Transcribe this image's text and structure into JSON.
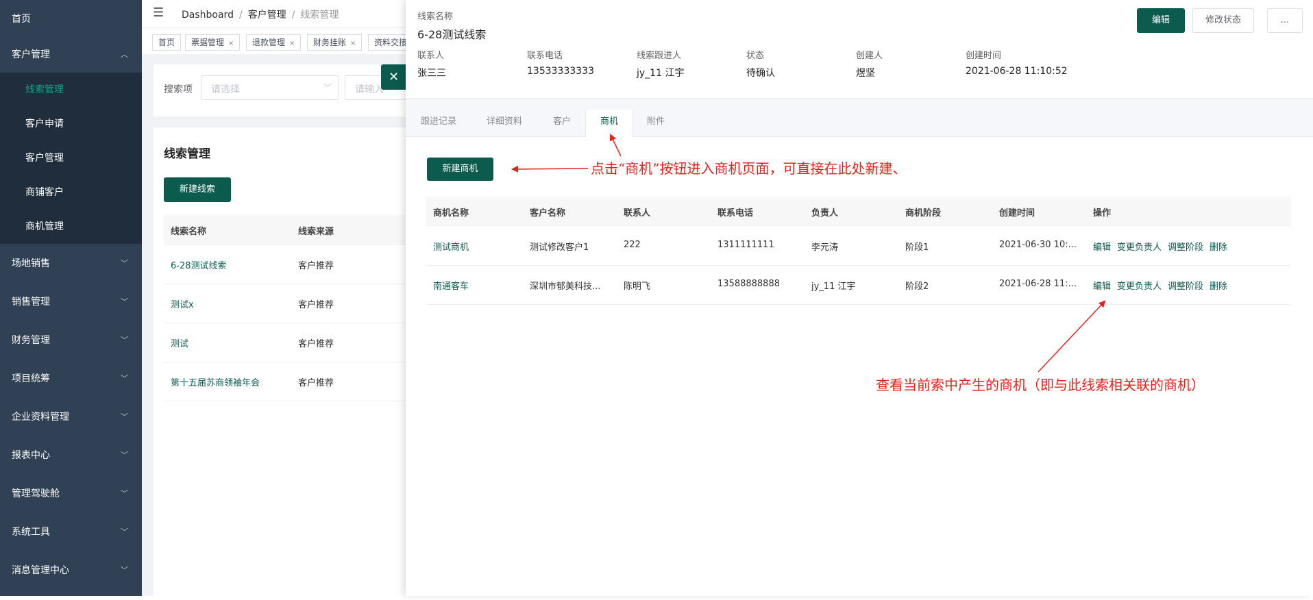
{
  "sidebar": {
    "top_items": [
      {
        "label": "首页"
      },
      {
        "label": "客户管理"
      }
    ],
    "sub_items": [
      {
        "label": "线索管理"
      },
      {
        "label": "客户申请"
      },
      {
        "label": "客户管理"
      },
      {
        "label": "商铺客户"
      },
      {
        "label": "商机管理"
      }
    ],
    "bottom_items": [
      {
        "label": "场地销售"
      },
      {
        "label": "销售管理"
      },
      {
        "label": "财务管理"
      },
      {
        "label": "项目统筹"
      },
      {
        "label": "企业资料管理"
      },
      {
        "label": "报表中心"
      },
      {
        "label": "管理驾驶舱"
      },
      {
        "label": "系统工具"
      },
      {
        "label": "消息管理中心"
      }
    ]
  },
  "header": {
    "breadcrumb": [
      "Dashboard",
      "客户管理",
      "线索管理"
    ]
  },
  "tags": [
    "首页",
    "票据管理",
    "退款管理",
    "财务挂账",
    "资料交接"
  ],
  "search": {
    "label": "搜索项",
    "select_placeholder": "请选择",
    "input_placeholder": "请输入"
  },
  "list": {
    "title": "线索管理",
    "new_button": "新建线索",
    "headers": [
      "线索名称",
      "线索来源"
    ],
    "rows": [
      {
        "name": "6-28测试线索",
        "source": "客户推荐"
      },
      {
        "name": "测试x",
        "source": "客户推荐"
      },
      {
        "name": "测试",
        "source": "客户推荐"
      },
      {
        "name": "第十五届苏商领袖年会",
        "source": "客户推荐"
      }
    ]
  },
  "drawer": {
    "name_label": "线索名称",
    "name": "6-28测试线索",
    "buttons": {
      "edit": "编辑",
      "change_status": "修改状态",
      "more": "..."
    },
    "fields": [
      {
        "label": "联系人",
        "value": "张三三"
      },
      {
        "label": "联系电话",
        "value": "13533333333"
      },
      {
        "label": "线索跟进人",
        "value": "jy_11 江宇"
      },
      {
        "label": "状态",
        "value": "待确认"
      },
      {
        "label": "创建人",
        "value": "煜坚"
      },
      {
        "label": "创建时间",
        "value": "2021-06-28 11:10:52"
      }
    ],
    "tabs": [
      "跟进记录",
      "详细资料",
      "客户",
      "商机",
      "附件"
    ],
    "active_tab": "商机",
    "new_business_button": "新建商机",
    "table": {
      "headers": [
        "商机名称",
        "客户名称",
        "联系人",
        "联系电话",
        "负责人",
        "商机阶段",
        "创建时间",
        "操作"
      ],
      "rows": [
        {
          "name": "测试商机",
          "customer": "测试修改客户1",
          "contact": "222",
          "phone": "1311111111",
          "owner": "李元涛",
          "stage": "阶段1",
          "created": "2021-06-30 10:...",
          "ops": [
            "编辑",
            "变更负责人",
            "调整阶段",
            "删除"
          ]
        },
        {
          "name": "南通客车",
          "customer": "深圳市郁美科技...",
          "contact": "陈明飞",
          "phone": "13588888888",
          "owner": "jy_11 江宇",
          "stage": "阶段2",
          "created": "2021-06-28 11:...",
          "ops": [
            "编辑",
            "变更负责人",
            "调整阶段",
            "删除"
          ]
        }
      ]
    }
  },
  "annotations": {
    "top": "点击“商机”按钮进入商机页面，可直接在此处新建、",
    "bottom": "查看当前索中产生的商机（即与此线索相关联的商机）"
  },
  "colors": {
    "sidebar_bg": "#304156",
    "submenu_bg": "#1f2d3d",
    "primary": "#0b5b4e",
    "active_text": "#13a487",
    "annotation": "#e8221b"
  },
  "icons": {
    "hamburger": "hamburger-icon",
    "chevron": "chevron-icon",
    "close": "close-icon"
  }
}
